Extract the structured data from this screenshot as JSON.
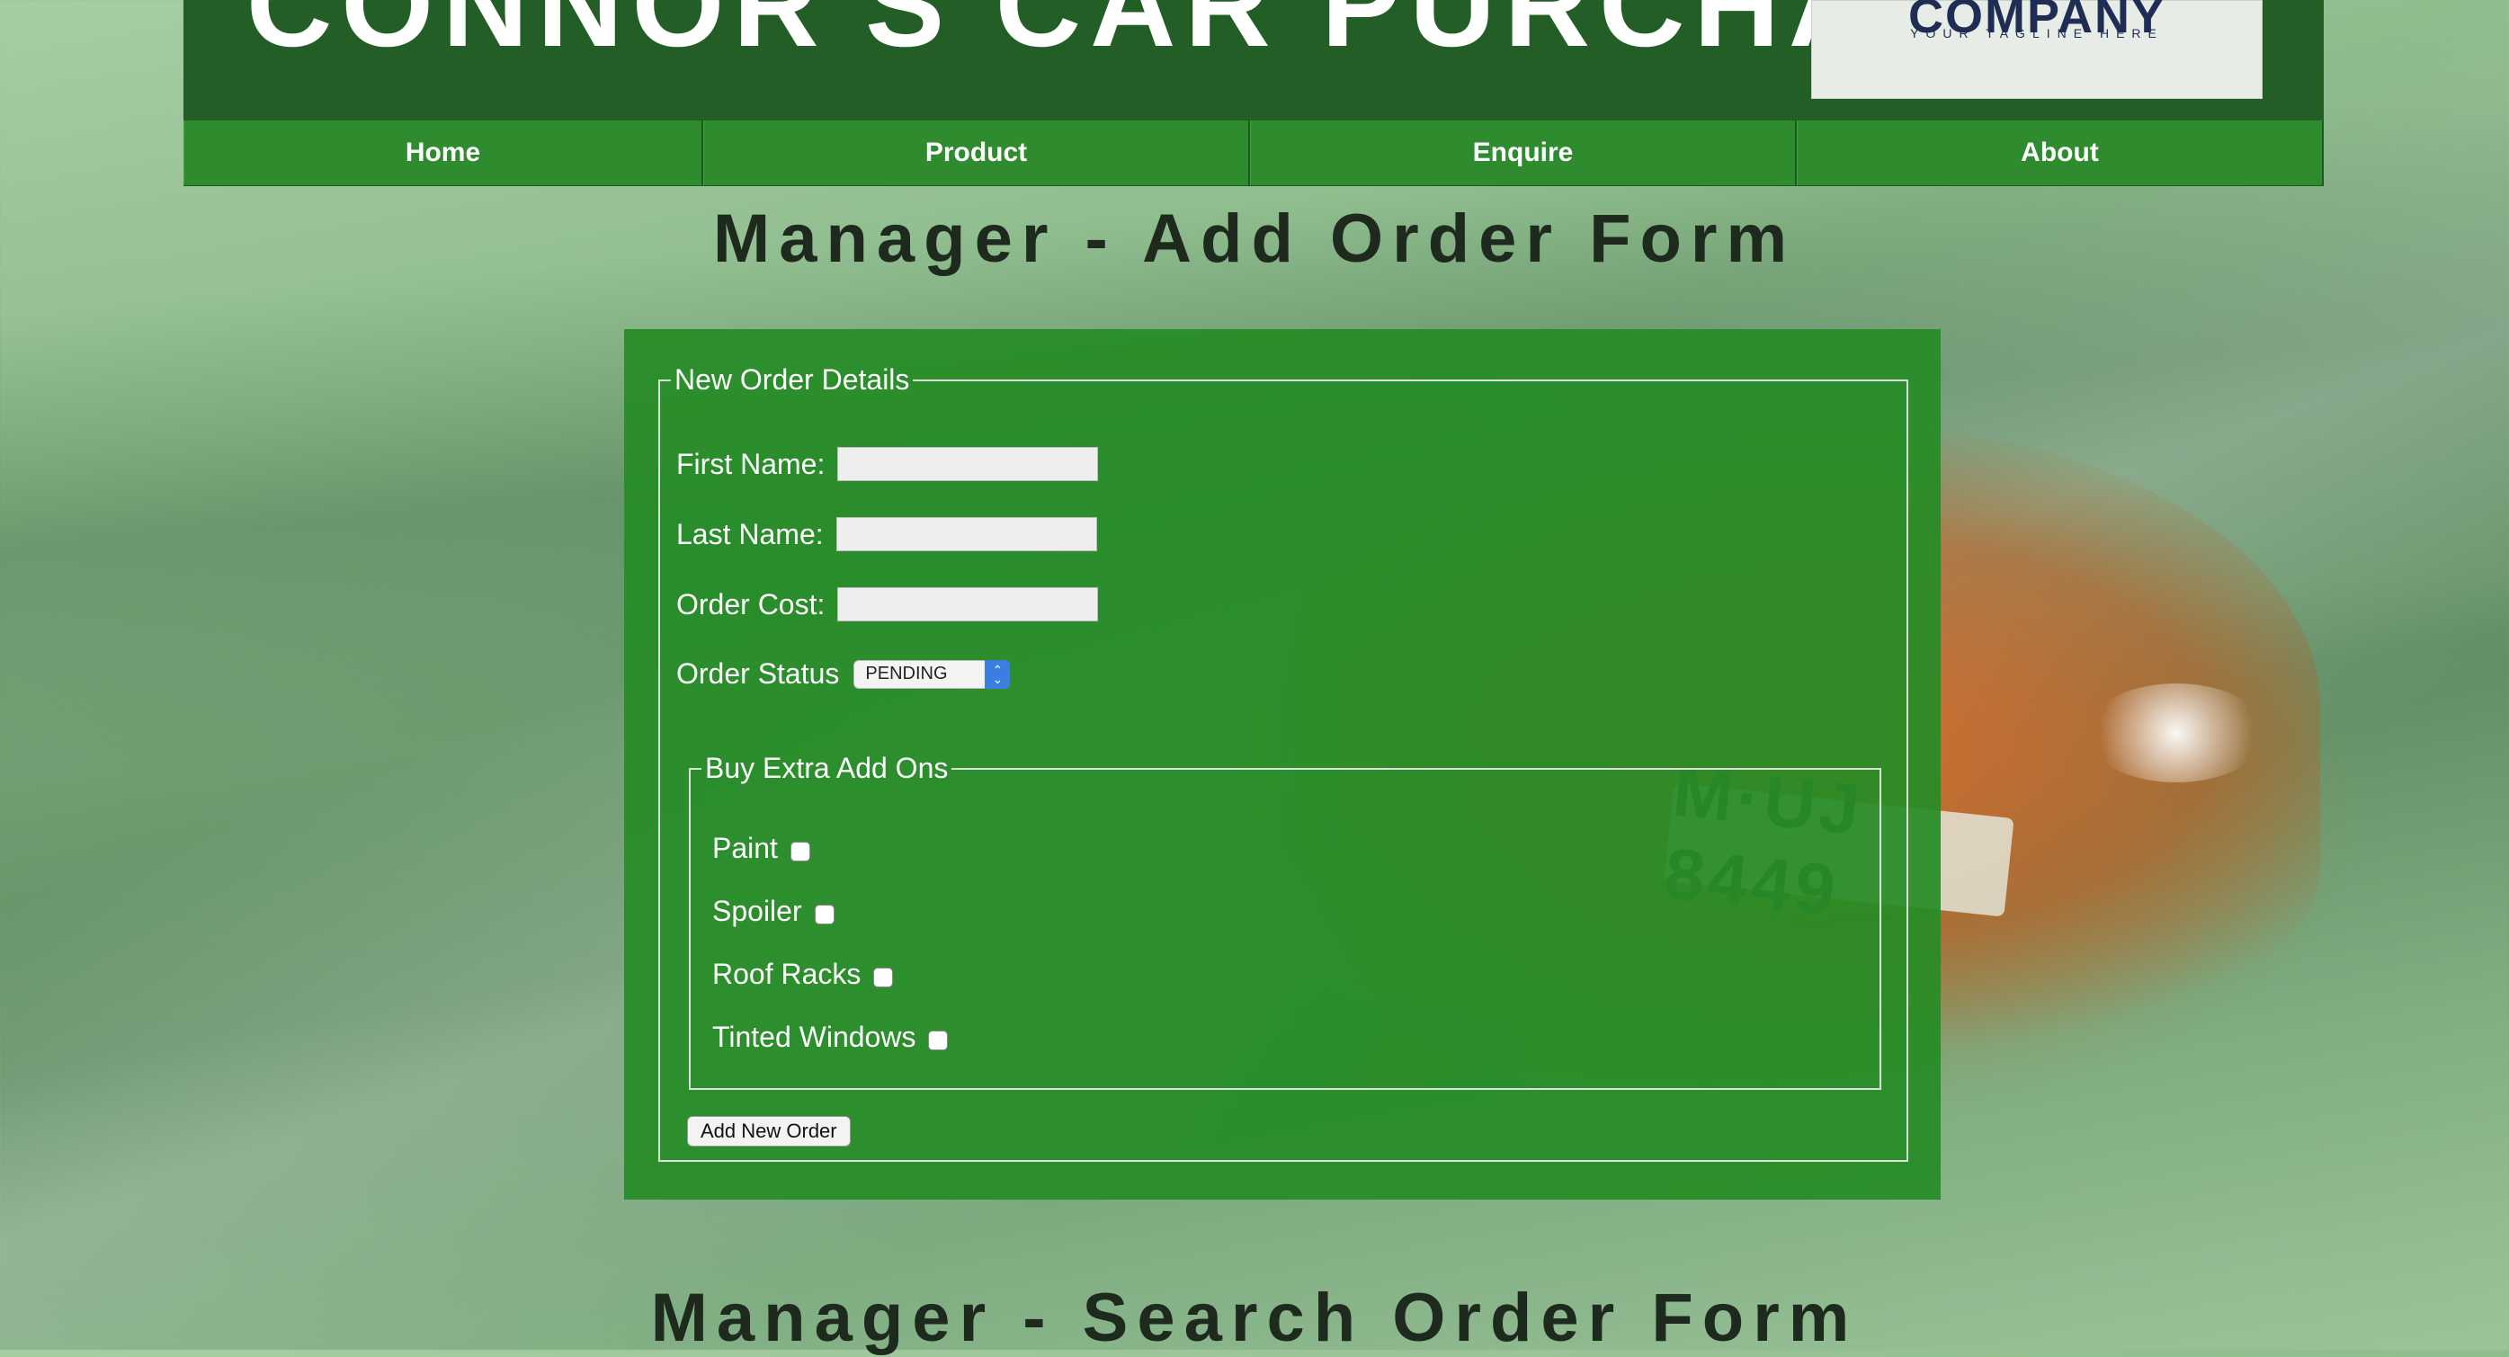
{
  "header": {
    "site_title": "CONNOR'S CAR PURCHASE",
    "logo_text": "COMPANY",
    "logo_tagline": "YOUR TAGLINE HERE"
  },
  "nav": {
    "items": [
      {
        "label": "Home"
      },
      {
        "label": "Product"
      },
      {
        "label": "Enquire"
      },
      {
        "label": "About"
      }
    ]
  },
  "background": {
    "plate_text": "M·UJ 8449"
  },
  "add_form": {
    "title": "Manager - Add Order Form",
    "legend": "New Order Details",
    "first_name_label": "First Name:",
    "first_name_value": "",
    "last_name_label": "Last Name:",
    "last_name_value": "",
    "order_cost_label": "Order Cost:",
    "order_cost_value": "",
    "status_label": "Order Status",
    "status_selected": "PENDING",
    "addons_legend": "Buy Extra Add Ons",
    "addons": [
      {
        "label": "Paint",
        "checked": false
      },
      {
        "label": "Spoiler",
        "checked": false
      },
      {
        "label": "Roof Racks",
        "checked": false
      },
      {
        "label": "Tinted Windows",
        "checked": false
      }
    ],
    "submit_label": "Add New Order"
  },
  "search_form": {
    "title": "Manager - Search Order Form"
  },
  "colors": {
    "header_bg": "#225e25",
    "nav_bg": "#2e8b2e",
    "panel_bg": "#268c26",
    "select_arrow": "#3b7de0"
  }
}
